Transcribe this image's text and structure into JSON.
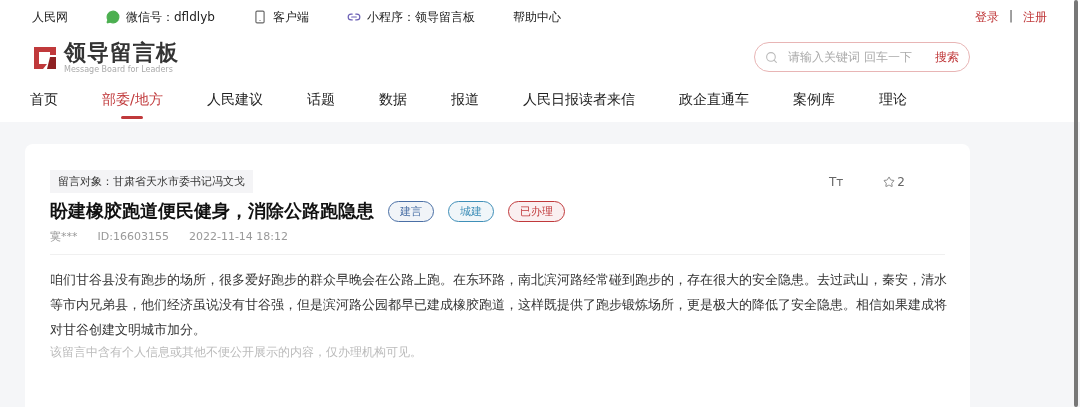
{
  "top_bar": {
    "links": [
      {
        "kind": "text",
        "label": "人民网"
      },
      {
        "kind": "wechat",
        "label": "微信号：dfldlyb"
      },
      {
        "kind": "phone",
        "label": "客户端"
      },
      {
        "kind": "mini",
        "label": "小程序：领导留言板"
      },
      {
        "kind": "text",
        "label": "帮助中心"
      }
    ],
    "login": "登录",
    "separator": "|",
    "register": "注册"
  },
  "logo": {
    "title": "领导留言板",
    "subtitle": "Message Board for Leaders"
  },
  "search": {
    "placeholder": "请输入关键词 回车一下",
    "button": "搜索"
  },
  "nav": [
    {
      "label": "首页",
      "selected": false
    },
    {
      "label": "部委/地方",
      "selected": true
    },
    {
      "label": "人民建议",
      "selected": false
    },
    {
      "label": "话题",
      "selected": false
    },
    {
      "label": "数据",
      "selected": false
    },
    {
      "label": "报道",
      "selected": false
    },
    {
      "label": "人民日报读者来信",
      "selected": false
    },
    {
      "label": "政企直通车",
      "selected": false
    },
    {
      "label": "案例库",
      "selected": false
    },
    {
      "label": "理论",
      "selected": false
    }
  ],
  "message": {
    "target": "留言对象：甘肃省天水市委书记冯文戈",
    "font_size_button": "Tт",
    "favorites": "2",
    "title": "盼建橡胶跑道便民健身，消除公路跑隐患",
    "tags": [
      {
        "label": "建言",
        "color": "#4a6fa5"
      },
      {
        "label": "城建",
        "color": "#3f8fb8"
      },
      {
        "label": "已办理",
        "color": "#c0393b"
      }
    ],
    "author": "寞***",
    "id": "ID:16603155",
    "time": "2022-11-14 18:12",
    "body": "咱们甘谷县没有跑步的场所，很多爱好跑步的群众早晚会在公路上跑。在东环路，南北滨河路经常碰到跑步的，存在很大的安全隐患。去过武山，秦安，清水等市内兄弟县，他们经济虽说没有甘谷强，但是滨河路公园都早已建成橡胶跑道，这样既提供了跑步锻炼场所，更是极大的降低了安全隐患。相信如果建成将对甘谷创建文明城市加分。",
    "notice": "该留言中含有个人信息或其他不便公开展示的内容，仅办理机构可见。"
  }
}
